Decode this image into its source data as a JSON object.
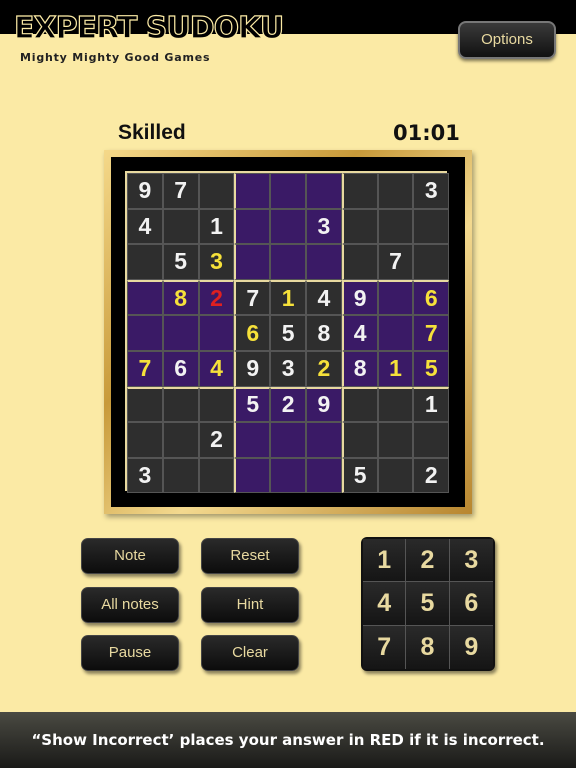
{
  "header": {
    "logo": "EXPERT SUDOKU",
    "tagline": "Mighty Mighty Good Games",
    "options_label": "Options"
  },
  "game": {
    "level": "Skilled",
    "timer": "01:01"
  },
  "board": [
    [
      "9",
      "7",
      "",
      "",
      "",
      "",
      "",
      "",
      "3"
    ],
    [
      "4",
      "",
      "1",
      "",
      "",
      "3",
      "",
      "",
      ""
    ],
    [
      "",
      "5",
      "3",
      "",
      "",
      "",
      "",
      "7",
      ""
    ],
    [
      "",
      "8",
      "2",
      "7",
      "1",
      "4",
      "9",
      "",
      "6"
    ],
    [
      "",
      "",
      "",
      "6",
      "5",
      "8",
      "4",
      "",
      "7"
    ],
    [
      "7",
      "6",
      "4",
      "9",
      "3",
      "2",
      "8",
      "1",
      "5"
    ],
    [
      "",
      "",
      "",
      "5",
      "2",
      "9",
      "",
      "",
      "1"
    ],
    [
      "",
      "",
      "2",
      "",
      "",
      "",
      "",
      "",
      ""
    ],
    [
      "3",
      "",
      "",
      "",
      "",
      "",
      "5",
      "",
      "2"
    ]
  ],
  "board_colors": [
    [
      "w",
      "w",
      "",
      "",
      "",
      "",
      "",
      "",
      "w"
    ],
    [
      "w",
      "",
      "w",
      "",
      "",
      "w",
      "",
      "",
      ""
    ],
    [
      "",
      "w",
      "y",
      "",
      "",
      "",
      "",
      "w",
      ""
    ],
    [
      "",
      "y",
      "r",
      "w",
      "y",
      "w",
      "w",
      "",
      "y"
    ],
    [
      "",
      "",
      "",
      "y",
      "w",
      "w",
      "w",
      "",
      "y"
    ],
    [
      "y",
      "w",
      "y",
      "w",
      "w",
      "y",
      "w",
      "y",
      "y"
    ],
    [
      "",
      "",
      "",
      "w",
      "w",
      "w",
      "",
      "",
      "w"
    ],
    [
      "",
      "",
      "w",
      "",
      "",
      "",
      "",
      "",
      ""
    ],
    [
      "w",
      "",
      "",
      "",
      "",
      "",
      "w",
      "",
      "w"
    ]
  ],
  "colors": {
    "background": "#fbeaa5",
    "highlight": "#3a1a66",
    "cell": "#2e2e2e",
    "given_digit": "#f2f2f2",
    "entered_digit": "#f6e13a",
    "incorrect_digit": "#e02020"
  },
  "controls": {
    "note": "Note",
    "reset": "Reset",
    "all_notes": "All notes",
    "hint": "Hint",
    "pause": "Pause",
    "clear": "Clear"
  },
  "numpad": [
    "1",
    "2",
    "3",
    "4",
    "5",
    "6",
    "7",
    "8",
    "9"
  ],
  "footer": {
    "tip": "“Show Incorrect’ places your answer in RED if it is incorrect."
  }
}
